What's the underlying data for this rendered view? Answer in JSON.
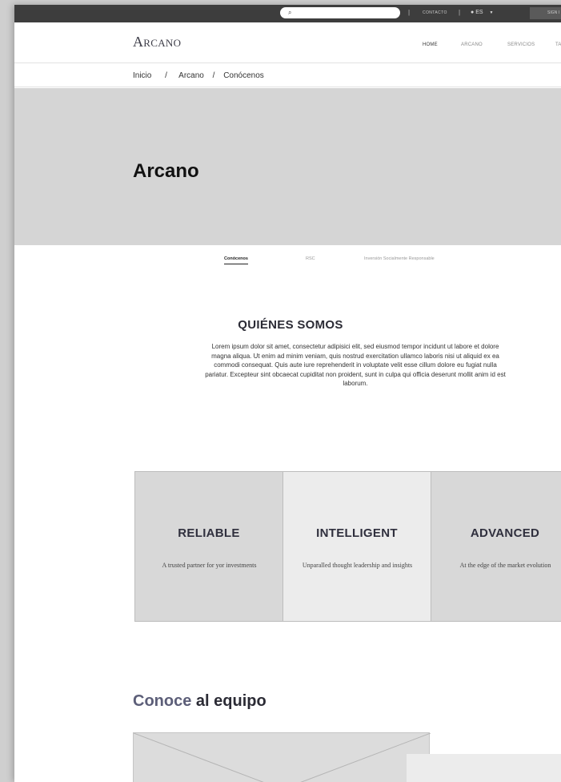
{
  "topbar": {
    "search_icon": "search-icon",
    "contact": "CONTACTO",
    "separator": "|",
    "language": "ES",
    "language_icon": "globe-icon",
    "sign_in": "SIGN I"
  },
  "header": {
    "logo": "Arcano",
    "nav": [
      "HOME",
      "ARCANO",
      "SERVICIOS",
      "TA"
    ]
  },
  "breadcrumb": [
    "Inicio",
    "/",
    "Arcano",
    "/",
    "Conócenos"
  ],
  "hero": {
    "title": "Arcano"
  },
  "subnav": [
    "Conócenos",
    "RSC",
    "Inversión Socialmente Responsable"
  ],
  "about": {
    "title": "QUIÉNES SOMOS",
    "text": "Lorem ipsum dolor sit amet, consectetur adipisici elit, sed eiusmod tempor incidunt ut labore et dolore magna aliqua. Ut enim ad minim veniam, quis nostrud exercitation ullamco laboris nisi ut aliquid ex ea commodi consequat. Quis aute iure reprehenderit in voluptate velit esse cillum dolore eu fugiat nulla pariatur. Excepteur sint obcaecat cupiditat non proident, sunt in culpa qui officia deserunt mollit anim id est laborum."
  },
  "cards": [
    {
      "title": "RELIABLE",
      "text": "A trusted partner for yor investments",
      "bg": "#d8d8d8"
    },
    {
      "title": "INTELLIGENT",
      "text": "Unparalled thought leadership and insights",
      "bg": "#ececec"
    },
    {
      "title": "ADVANCED",
      "text": "At the edge of the market evolution",
      "bg": "#d8d8d8"
    }
  ],
  "team": {
    "title_accent": "Conoce",
    "title_rest": " al equipo"
  }
}
